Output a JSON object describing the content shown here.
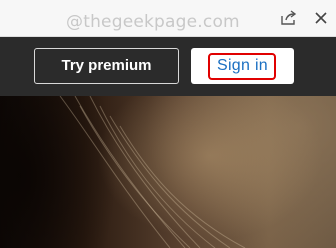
{
  "toolbar": {
    "watermark": "@thegeekpage.com",
    "icons": [
      "share-icon",
      "close-icon"
    ]
  },
  "header": {
    "premium_label": "Try premium",
    "signin_label": "Sign in"
  },
  "colors": {
    "header_bg": "#2b2b2b",
    "signin_text": "#1a6fc2",
    "highlight": "#e00000"
  }
}
